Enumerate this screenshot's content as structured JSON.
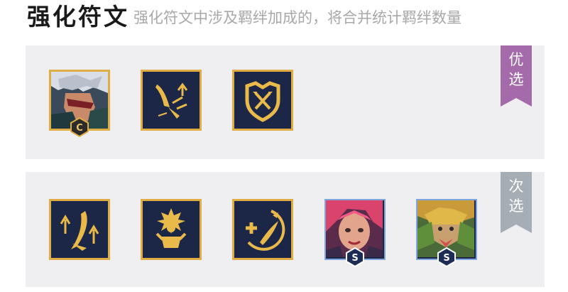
{
  "header": {
    "title": "强化符文",
    "subtitle": "强化符文中涉及羁绊加成的，将合并统计羁绊数量"
  },
  "colors": {
    "tile_bg": "#1c2748",
    "gold_border": "#e0ad45",
    "silver_border": "#7ea5dd",
    "primary_tag": "#a46aa9",
    "secondary_tag": "#a5adb5",
    "panel_bg": "#efeff2"
  },
  "sections": [
    {
      "tag": [
        "优",
        "选"
      ],
      "items": [
        {
          "kind": "champion",
          "icon": "white-haired-champion-portrait",
          "badge": "C"
        },
        {
          "kind": "augment",
          "icon": "blade-dash-icon"
        },
        {
          "kind": "augment",
          "icon": "crossed-swords-shield-icon"
        }
      ]
    },
    {
      "tag": [
        "次",
        "选"
      ],
      "items": [
        {
          "kind": "augment",
          "icon": "twin-blades-icon"
        },
        {
          "kind": "augment",
          "icon": "burst-figure-icon"
        },
        {
          "kind": "augment",
          "icon": "plus-blade-crescent-icon"
        },
        {
          "kind": "champion",
          "icon": "pink-haired-champion-portrait",
          "badge": "S"
        },
        {
          "kind": "champion",
          "icon": "beast-masked-champion-portrait",
          "badge": "S"
        }
      ]
    }
  ]
}
